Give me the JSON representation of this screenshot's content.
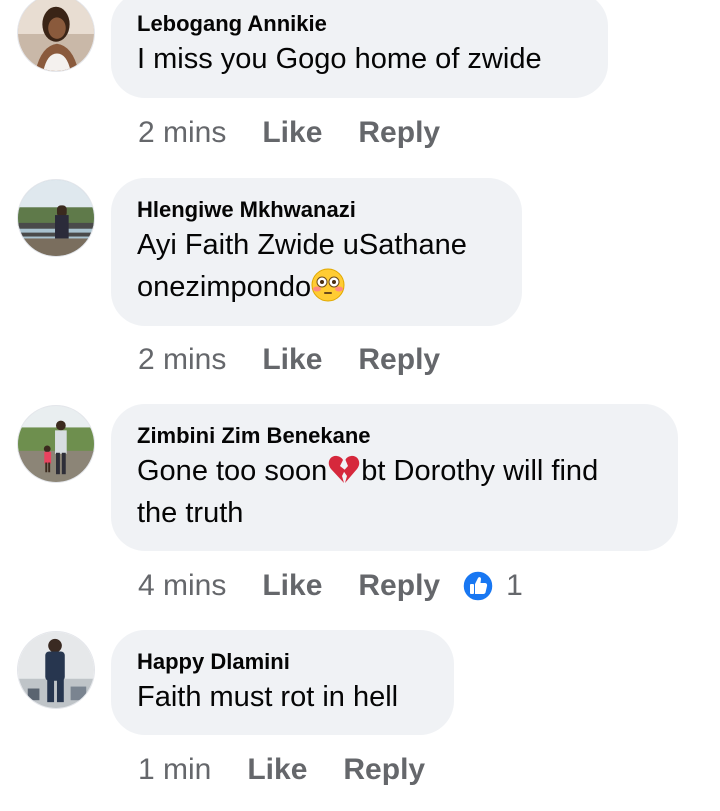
{
  "comments": [
    {
      "author": "Lebogang Annikie",
      "text": "I miss you Gogo home of zwide",
      "time": "2 mins",
      "like_label": "Like",
      "reply_label": "Reply"
    },
    {
      "author": "Hlengiwe Mkhwanazi",
      "text_line1": "Ayi Faith Zwide uSathane",
      "text_line2": "onezimpondo",
      "emoji": "flushed-face",
      "time": "2 mins",
      "like_label": "Like",
      "reply_label": "Reply"
    },
    {
      "author": "Zimbini Zim Benekane",
      "text_part1": "Gone too soon",
      "text_part2": "bt Dorothy will find",
      "text_line2": "the truth",
      "emoji": "broken-heart",
      "time": "4 mins",
      "like_label": "Like",
      "reply_label": "Reply",
      "reaction_icon": "thumbs-up",
      "reaction_count": "1"
    },
    {
      "author": "Happy Dlamini",
      "text": "Faith must rot in hell",
      "time": "1 min",
      "like_label": "Like",
      "reply_label": "Reply"
    }
  ],
  "colors": {
    "bubble": "#f0f2f5",
    "secondary_text": "#65676b",
    "like_blue": "#1877f2"
  }
}
